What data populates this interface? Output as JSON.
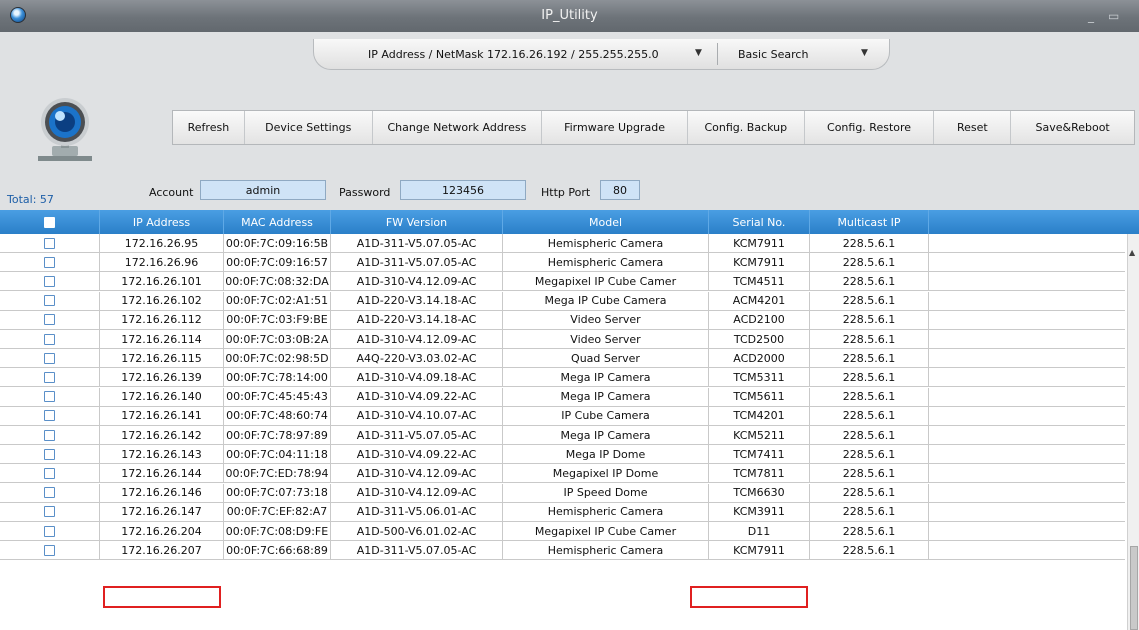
{
  "window": {
    "title": "IP_Utility",
    "minimize": "_",
    "restore": "▭"
  },
  "search": {
    "ipmask_label": "IP Address / NetMask  172.16.26.192 / 255.255.255.0",
    "mode": "Basic Search"
  },
  "toolbar": {
    "refresh": "Refresh",
    "device_settings": "Device Settings",
    "change_network_address": "Change Network Address",
    "firmware_upgrade": "Firmware Upgrade",
    "config_backup": "Config. Backup",
    "config_restore": "Config. Restore",
    "reset": "Reset",
    "save_reboot": "Save&Reboot"
  },
  "total": "Total: 57",
  "credentials": {
    "account_label": "Account",
    "account_value": "admin",
    "password_label": "Password",
    "password_value": "123456",
    "http_port_label": "Http Port",
    "http_port_value": "80"
  },
  "table": {
    "columns": [
      "IP Address",
      "MAC Address",
      "FW Version",
      "Model",
      "Serial No.",
      "Multicast IP"
    ],
    "rows": [
      [
        "172.16.26.95",
        "00:0F:7C:09:16:5B",
        "A1D-311-V5.07.05-AC",
        "Hemispheric Camera",
        "KCM7911",
        "228.5.6.1"
      ],
      [
        "172.16.26.96",
        "00:0F:7C:09:16:57",
        "A1D-311-V5.07.05-AC",
        "Hemispheric Camera",
        "KCM7911",
        "228.5.6.1"
      ],
      [
        "172.16.26.101",
        "00:0F:7C:08:32:DA",
        "A1D-310-V4.12.09-AC",
        "Megapixel IP Cube Camer",
        "TCM4511",
        "228.5.6.1"
      ],
      [
        "172.16.26.102",
        "00:0F:7C:02:A1:51",
        "A1D-220-V3.14.18-AC",
        "Mega IP Cube Camera",
        "ACM4201",
        "228.5.6.1"
      ],
      [
        "172.16.26.112",
        "00:0F:7C:03:F9:BE",
        "A1D-220-V3.14.18-AC",
        "Video Server",
        "ACD2100",
        "228.5.6.1"
      ],
      [
        "172.16.26.114",
        "00:0F:7C:03:0B:2A",
        "A1D-310-V4.12.09-AC",
        "Video Server",
        "TCD2500",
        "228.5.6.1"
      ],
      [
        "172.16.26.115",
        "00:0F:7C:02:98:5D",
        "A4Q-220-V3.03.02-AC",
        "Quad Server",
        "ACD2000",
        "228.5.6.1"
      ],
      [
        "172.16.26.139",
        "00:0F:7C:78:14:00",
        "A1D-310-V4.09.18-AC",
        "Mega IP Camera",
        "TCM5311",
        "228.5.6.1"
      ],
      [
        "172.16.26.140",
        "00:0F:7C:45:45:43",
        "A1D-310-V4.09.22-AC",
        "Mega IP Camera",
        "TCM5611",
        "228.5.6.1"
      ],
      [
        "172.16.26.141",
        "00:0F:7C:48:60:74",
        "A1D-310-V4.10.07-AC",
        "IP Cube Camera",
        "TCM4201",
        "228.5.6.1"
      ],
      [
        "172.16.26.142",
        "00:0F:7C:78:97:89",
        "A1D-311-V5.07.05-AC",
        "Mega IP Camera",
        "KCM5211",
        "228.5.6.1"
      ],
      [
        "172.16.26.143",
        "00:0F:7C:04:11:18",
        "A1D-310-V4.09.22-AC",
        "Mega IP Dome",
        "TCM7411",
        "228.5.6.1"
      ],
      [
        "172.16.26.144",
        "00:0F:7C:ED:78:94",
        "A1D-310-V4.12.09-AC",
        "Megapixel IP Dome",
        "TCM7811",
        "228.5.6.1"
      ],
      [
        "172.16.26.146",
        "00:0F:7C:07:73:18",
        "A1D-310-V4.12.09-AC",
        "IP Speed Dome",
        "TCM6630",
        "228.5.6.1"
      ],
      [
        "172.16.26.147",
        "00:0F:7C:EF:82:A7",
        "A1D-311-V5.06.01-AC",
        "Hemispheric Camera",
        "KCM3911",
        "228.5.6.1"
      ],
      [
        "172.16.26.204",
        "00:0F:7C:08:D9:FE",
        "A1D-500-V6.01.02-AC",
        "Megapixel IP Cube Camer",
        "D11",
        "228.5.6.1"
      ],
      [
        "172.16.26.207",
        "00:0F:7C:66:68:89",
        "A1D-311-V5.07.05-AC",
        "Hemispheric Camera",
        "KCM7911",
        "228.5.6.1"
      ]
    ]
  },
  "colors": {
    "header_blue": "#2a7fc8",
    "highlight_red": "#e02020",
    "input_blue": "#cfe3f6"
  }
}
